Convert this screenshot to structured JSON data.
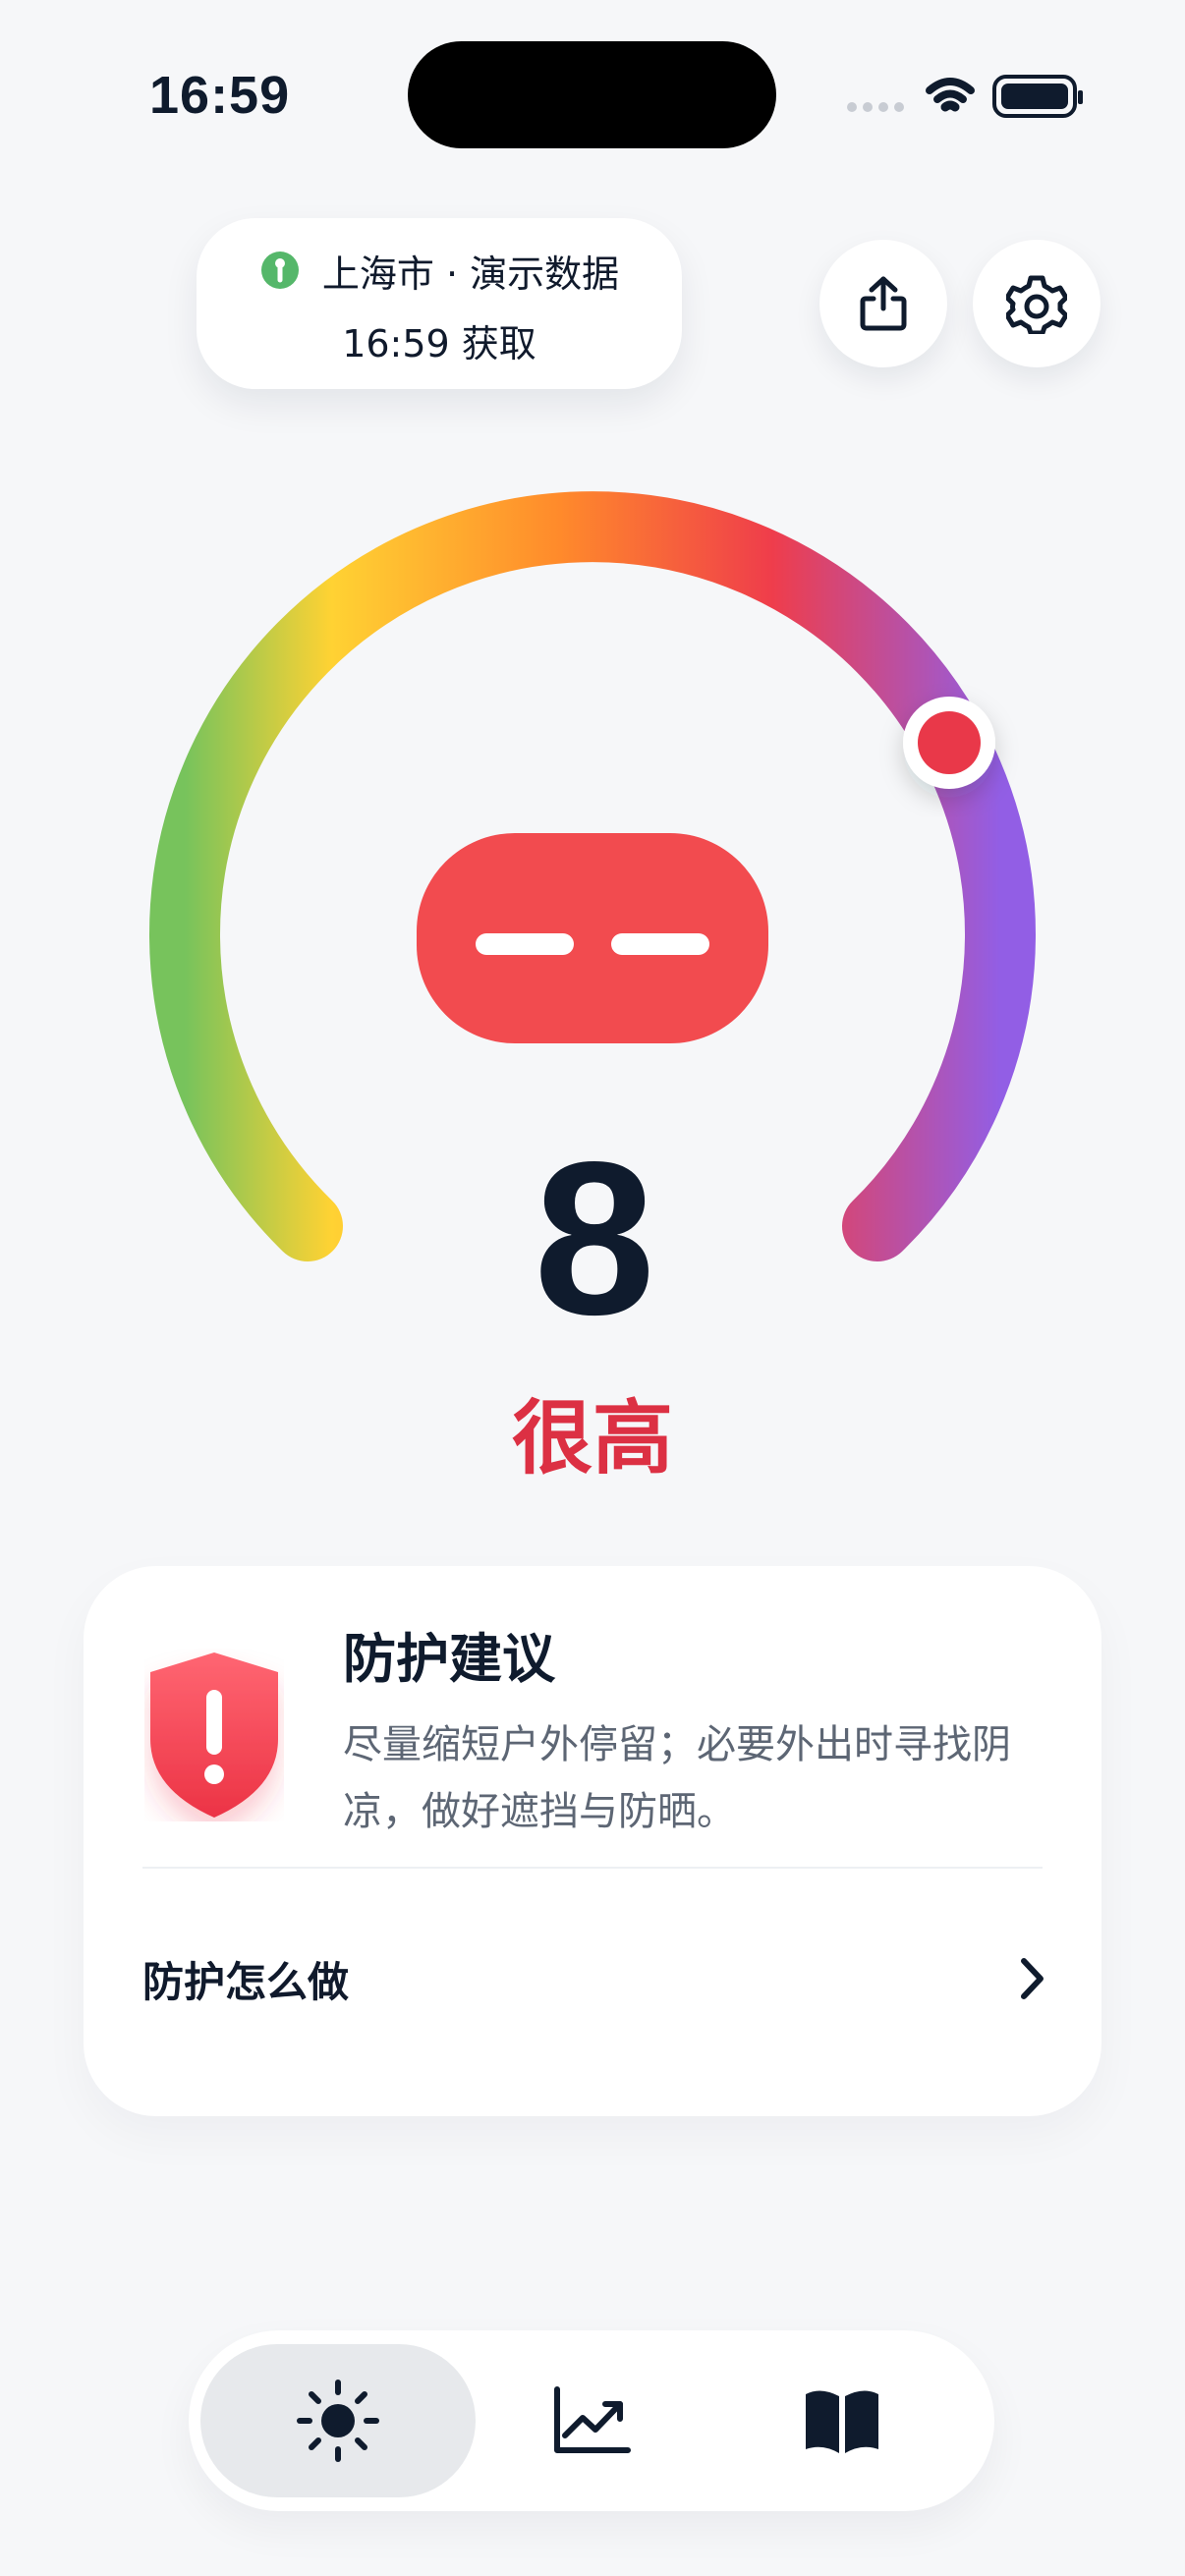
{
  "status_bar": {
    "time": "16:59"
  },
  "location": {
    "label": "上海市 · 演示数据",
    "fetched_time": "16:59 获取",
    "pin_color": "#55b76a"
  },
  "actions": {
    "share_icon": "share-icon",
    "settings_icon": "gear-icon"
  },
  "uv": {
    "index": "8",
    "level": "很高",
    "accent_color": "#dc3043",
    "face_color": "#f24b4f"
  },
  "advice": {
    "title": "防护建议",
    "text": "尽量缩短户外停留；必要外出时寻找阴凉，做好遮挡与防晒。",
    "how_to_label": "防护怎么做"
  },
  "tab_bar": {
    "items": [
      {
        "icon": "sun-icon",
        "selected": true
      },
      {
        "icon": "chart-trend-icon",
        "selected": false
      },
      {
        "icon": "book-icon",
        "selected": false
      }
    ]
  }
}
